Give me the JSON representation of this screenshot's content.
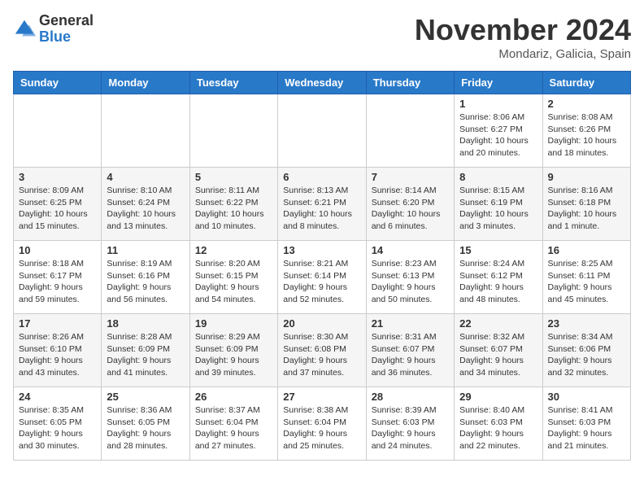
{
  "header": {
    "logo_general": "General",
    "logo_blue": "Blue",
    "month": "November 2024",
    "location": "Mondariz, Galicia, Spain"
  },
  "weekdays": [
    "Sunday",
    "Monday",
    "Tuesday",
    "Wednesday",
    "Thursday",
    "Friday",
    "Saturday"
  ],
  "weeks": [
    [
      {
        "day": "",
        "info": ""
      },
      {
        "day": "",
        "info": ""
      },
      {
        "day": "",
        "info": ""
      },
      {
        "day": "",
        "info": ""
      },
      {
        "day": "",
        "info": ""
      },
      {
        "day": "1",
        "info": "Sunrise: 8:06 AM\nSunset: 6:27 PM\nDaylight: 10 hours and 20 minutes."
      },
      {
        "day": "2",
        "info": "Sunrise: 8:08 AM\nSunset: 6:26 PM\nDaylight: 10 hours and 18 minutes."
      }
    ],
    [
      {
        "day": "3",
        "info": "Sunrise: 8:09 AM\nSunset: 6:25 PM\nDaylight: 10 hours and 15 minutes."
      },
      {
        "day": "4",
        "info": "Sunrise: 8:10 AM\nSunset: 6:24 PM\nDaylight: 10 hours and 13 minutes."
      },
      {
        "day": "5",
        "info": "Sunrise: 8:11 AM\nSunset: 6:22 PM\nDaylight: 10 hours and 10 minutes."
      },
      {
        "day": "6",
        "info": "Sunrise: 8:13 AM\nSunset: 6:21 PM\nDaylight: 10 hours and 8 minutes."
      },
      {
        "day": "7",
        "info": "Sunrise: 8:14 AM\nSunset: 6:20 PM\nDaylight: 10 hours and 6 minutes."
      },
      {
        "day": "8",
        "info": "Sunrise: 8:15 AM\nSunset: 6:19 PM\nDaylight: 10 hours and 3 minutes."
      },
      {
        "day": "9",
        "info": "Sunrise: 8:16 AM\nSunset: 6:18 PM\nDaylight: 10 hours and 1 minute."
      }
    ],
    [
      {
        "day": "10",
        "info": "Sunrise: 8:18 AM\nSunset: 6:17 PM\nDaylight: 9 hours and 59 minutes."
      },
      {
        "day": "11",
        "info": "Sunrise: 8:19 AM\nSunset: 6:16 PM\nDaylight: 9 hours and 56 minutes."
      },
      {
        "day": "12",
        "info": "Sunrise: 8:20 AM\nSunset: 6:15 PM\nDaylight: 9 hours and 54 minutes."
      },
      {
        "day": "13",
        "info": "Sunrise: 8:21 AM\nSunset: 6:14 PM\nDaylight: 9 hours and 52 minutes."
      },
      {
        "day": "14",
        "info": "Sunrise: 8:23 AM\nSunset: 6:13 PM\nDaylight: 9 hours and 50 minutes."
      },
      {
        "day": "15",
        "info": "Sunrise: 8:24 AM\nSunset: 6:12 PM\nDaylight: 9 hours and 48 minutes."
      },
      {
        "day": "16",
        "info": "Sunrise: 8:25 AM\nSunset: 6:11 PM\nDaylight: 9 hours and 45 minutes."
      }
    ],
    [
      {
        "day": "17",
        "info": "Sunrise: 8:26 AM\nSunset: 6:10 PM\nDaylight: 9 hours and 43 minutes."
      },
      {
        "day": "18",
        "info": "Sunrise: 8:28 AM\nSunset: 6:09 PM\nDaylight: 9 hours and 41 minutes."
      },
      {
        "day": "19",
        "info": "Sunrise: 8:29 AM\nSunset: 6:09 PM\nDaylight: 9 hours and 39 minutes."
      },
      {
        "day": "20",
        "info": "Sunrise: 8:30 AM\nSunset: 6:08 PM\nDaylight: 9 hours and 37 minutes."
      },
      {
        "day": "21",
        "info": "Sunrise: 8:31 AM\nSunset: 6:07 PM\nDaylight: 9 hours and 36 minutes."
      },
      {
        "day": "22",
        "info": "Sunrise: 8:32 AM\nSunset: 6:07 PM\nDaylight: 9 hours and 34 minutes."
      },
      {
        "day": "23",
        "info": "Sunrise: 8:34 AM\nSunset: 6:06 PM\nDaylight: 9 hours and 32 minutes."
      }
    ],
    [
      {
        "day": "24",
        "info": "Sunrise: 8:35 AM\nSunset: 6:05 PM\nDaylight: 9 hours and 30 minutes."
      },
      {
        "day": "25",
        "info": "Sunrise: 8:36 AM\nSunset: 6:05 PM\nDaylight: 9 hours and 28 minutes."
      },
      {
        "day": "26",
        "info": "Sunrise: 8:37 AM\nSunset: 6:04 PM\nDaylight: 9 hours and 27 minutes."
      },
      {
        "day": "27",
        "info": "Sunrise: 8:38 AM\nSunset: 6:04 PM\nDaylight: 9 hours and 25 minutes."
      },
      {
        "day": "28",
        "info": "Sunrise: 8:39 AM\nSunset: 6:03 PM\nDaylight: 9 hours and 24 minutes."
      },
      {
        "day": "29",
        "info": "Sunrise: 8:40 AM\nSunset: 6:03 PM\nDaylight: 9 hours and 22 minutes."
      },
      {
        "day": "30",
        "info": "Sunrise: 8:41 AM\nSunset: 6:03 PM\nDaylight: 9 hours and 21 minutes."
      }
    ]
  ]
}
